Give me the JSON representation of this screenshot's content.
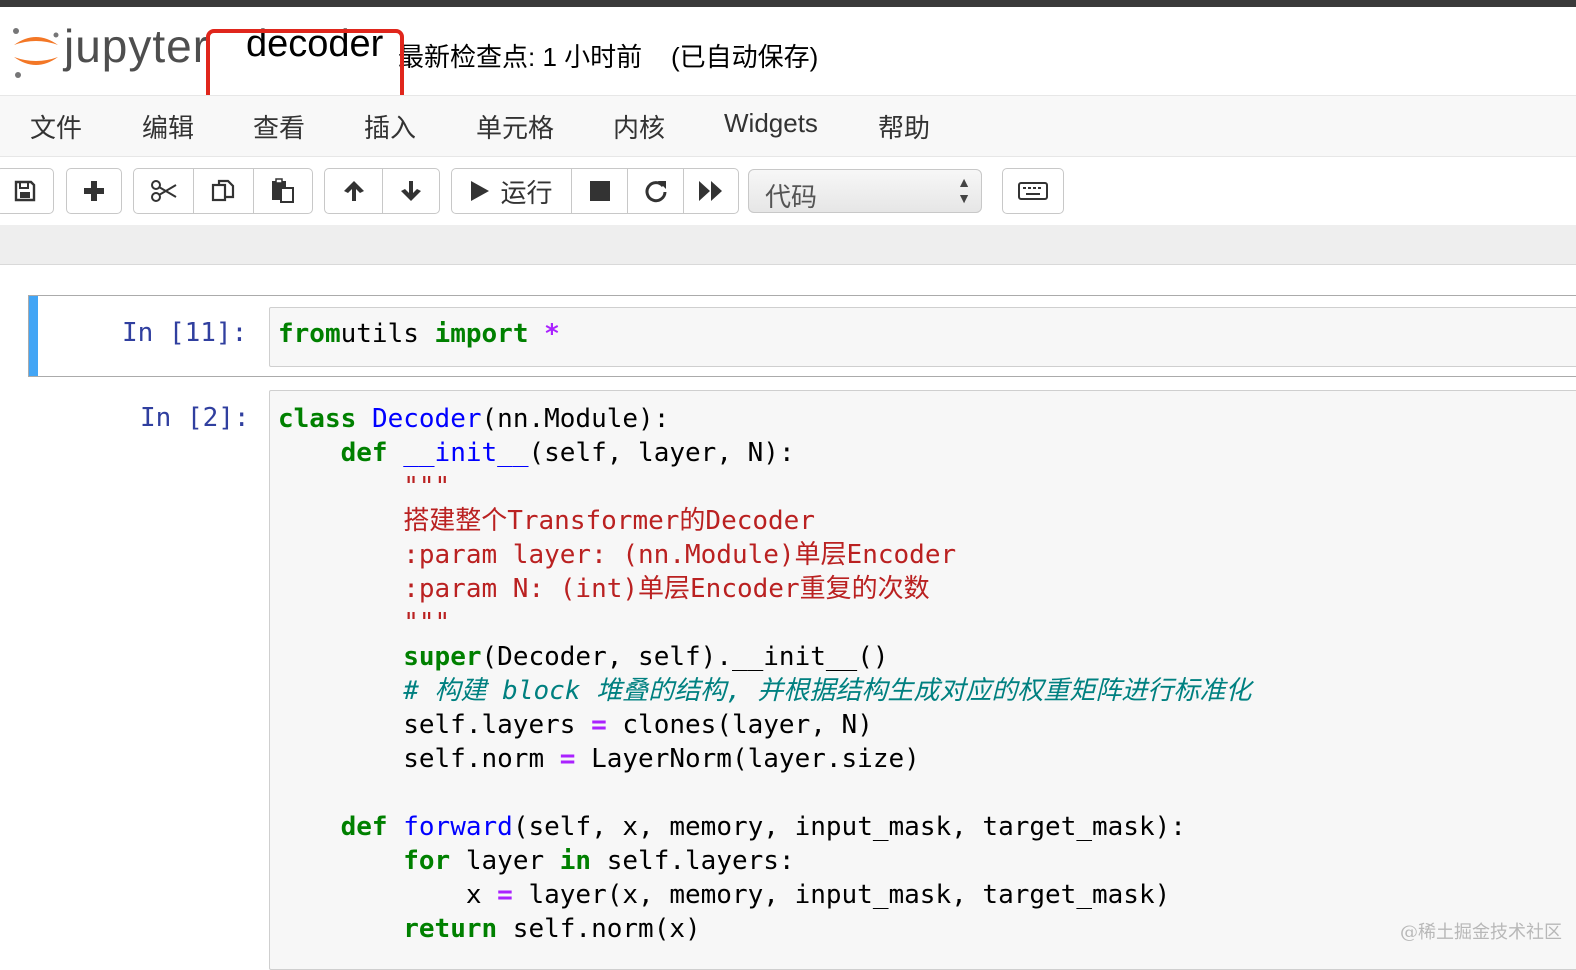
{
  "header": {
    "logo_text": "jupyter",
    "notebook_name": "decoder",
    "checkpoint": "最新检查点: 1 小时前    (已自动保存)"
  },
  "menu": [
    "文件",
    "编辑",
    "查看",
    "插入",
    "单元格",
    "内核",
    "Widgets",
    "帮助"
  ],
  "toolbar": {
    "run_label": "运行",
    "cell_type": "代码",
    "icons": [
      "save-icon",
      "plus-icon",
      "cut-icon",
      "copy-icon",
      "paste-icon",
      "arrow-up-icon",
      "arrow-down-icon",
      "play-icon",
      "stop-icon",
      "restart-icon",
      "fast-forward-icon",
      "keyboard-icon"
    ]
  },
  "cells": [
    {
      "prompt": "In [11]:",
      "lines": [
        [
          [
            "kw",
            "from"
          ],
          [
            "",
            "utils "
          ],
          [
            "kw",
            "import"
          ],
          [
            "op",
            " *"
          ]
        ]
      ]
    },
    {
      "prompt": "In [2]:",
      "lines": [
        [
          [
            "kw",
            "class"
          ],
          [
            "",
            " "
          ],
          [
            "def",
            "Decoder"
          ],
          [
            "",
            "(nn.Module):"
          ]
        ],
        [
          [
            "",
            "    "
          ],
          [
            "kw",
            "def"
          ],
          [
            "",
            " "
          ],
          [
            "def",
            "__init__"
          ],
          [
            "",
            "(self, layer, N):"
          ]
        ],
        [
          [
            "str",
            "        \"\"\""
          ]
        ],
        [
          [
            "str",
            "        搭建整个Transformer的Decoder"
          ]
        ],
        [
          [
            "str",
            "        :param layer: (nn.Module)单层Encoder"
          ]
        ],
        [
          [
            "str",
            "        :param N: (int)单层Encoder重复的次数"
          ]
        ],
        [
          [
            "str",
            "        \"\"\""
          ]
        ],
        [
          [
            "",
            "        "
          ],
          [
            "kw",
            "super"
          ],
          [
            "",
            "(Decoder, self).__init__()"
          ]
        ],
        [
          [
            "cmt",
            "        # 构建 block 堆叠的结构, 并根据结构生成对应的权重矩阵进行标准化"
          ]
        ],
        [
          [
            "",
            "        self.layers "
          ],
          [
            "op",
            "="
          ],
          [
            "",
            " clones(layer, N)"
          ]
        ],
        [
          [
            "",
            "        self.norm "
          ],
          [
            "op",
            "="
          ],
          [
            "",
            " LayerNorm(layer.size)"
          ]
        ],
        [
          [
            "",
            ""
          ]
        ],
        [
          [
            "",
            "    "
          ],
          [
            "kw",
            "def"
          ],
          [
            "",
            " "
          ],
          [
            "def",
            "forward"
          ],
          [
            "",
            "(self, x, memory, input_mask, target_mask):"
          ]
        ],
        [
          [
            "",
            "        "
          ],
          [
            "kw",
            "for"
          ],
          [
            "",
            " layer "
          ],
          [
            "kw",
            "in"
          ],
          [
            "",
            " self.layers:"
          ]
        ],
        [
          [
            "",
            "            x "
          ],
          [
            "op",
            "="
          ],
          [
            "",
            " layer(x, memory, input_mask, target_mask)"
          ]
        ],
        [
          [
            "",
            "        "
          ],
          [
            "kw",
            "return"
          ],
          [
            "",
            " self.norm(x)"
          ]
        ]
      ]
    }
  ],
  "watermark": "@稀土掘金技术社区"
}
